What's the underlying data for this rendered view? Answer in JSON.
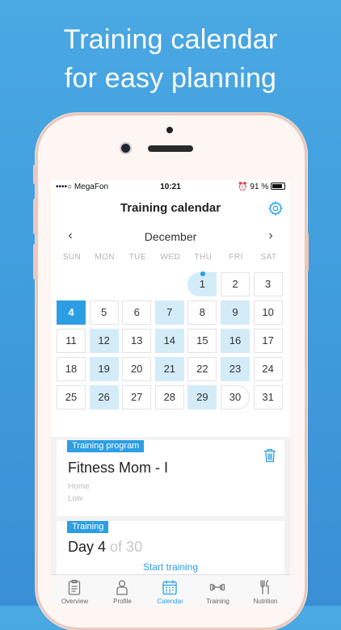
{
  "promo": {
    "line1": "Training calendar",
    "line2": "for easy planning"
  },
  "status_bar": {
    "carrier": "••••○ MegaFon",
    "time": "10:21",
    "battery": "91 %"
  },
  "navbar": {
    "title": "Training calendar",
    "settings_icon": "gear-icon"
  },
  "calendar": {
    "month": "December",
    "prev_icon": "chevron-left-icon",
    "next_icon": "chevron-right-icon",
    "weekdays": [
      "SUN",
      "MON",
      "TUE",
      "WED",
      "THU",
      "FRI",
      "SAT"
    ],
    "today": 4,
    "planned_days": [
      1,
      7,
      9,
      12,
      14,
      16,
      19,
      21,
      23,
      26,
      29
    ],
    "weeks": [
      [
        null,
        null,
        null,
        null,
        1,
        2,
        3
      ],
      [
        4,
        5,
        6,
        7,
        8,
        9,
        10
      ],
      [
        11,
        12,
        13,
        14,
        15,
        16,
        17
      ],
      [
        18,
        19,
        20,
        21,
        22,
        23,
        24
      ],
      [
        25,
        26,
        27,
        28,
        29,
        30,
        31
      ]
    ]
  },
  "program": {
    "tag": "Training program",
    "name": "Fitness Mom - I",
    "location": "Home",
    "level": "Low",
    "delete_icon": "trash-icon"
  },
  "training": {
    "tag": "Training",
    "day_label": "Day 4",
    "of_label": "of 30",
    "start_label": "Start training"
  },
  "tabs": [
    {
      "label": "Overview",
      "icon": "clipboard-icon",
      "active": false
    },
    {
      "label": "Profile",
      "icon": "person-icon",
      "active": false
    },
    {
      "label": "Calendar",
      "icon": "calendar-icon",
      "active": true
    },
    {
      "label": "Training",
      "icon": "dumbbell-icon",
      "active": false
    },
    {
      "label": "Nutrition",
      "icon": "fork-knife-icon",
      "active": false
    }
  ],
  "colors": {
    "accent": "#2b9ee4",
    "planned": "#d3ecf8",
    "background": "#4aa8e3"
  }
}
